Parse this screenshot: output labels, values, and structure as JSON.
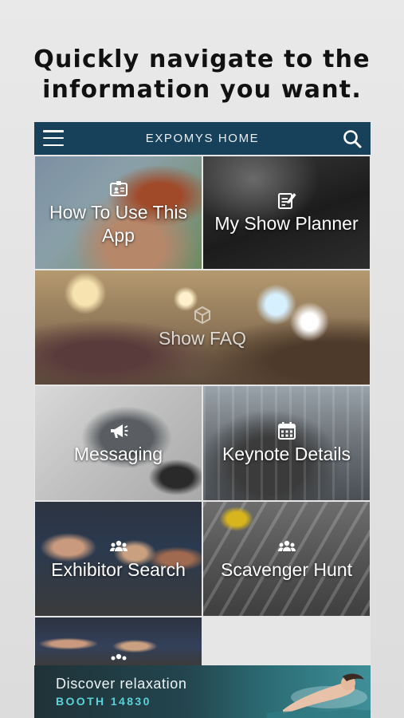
{
  "headline": {
    "line1": "Quickly navigate to the",
    "line2": "information you want."
  },
  "appbar": {
    "title": "EXPOMYS HOME",
    "menu_icon": "hamburger-menu-icon",
    "search_icon": "search-icon",
    "color": "#17405a"
  },
  "tiles": [
    {
      "label": "How To Use This App",
      "icon": "badge-icon"
    },
    {
      "label": "My Show Planner",
      "icon": "planner-edit-icon"
    },
    {
      "label": "Show FAQ",
      "icon": "cube-icon"
    },
    {
      "label": "Messaging",
      "icon": "megaphone-icon"
    },
    {
      "label": "Keynote Details",
      "icon": "calendar-icon"
    },
    {
      "label": "Exhibitor Search",
      "icon": "people-icon"
    },
    {
      "label": "Scavenger Hunt",
      "icon": "people-icon"
    }
  ],
  "banner": {
    "line1": "Discover relaxation",
    "line2": "BOOTH 14830",
    "accent": "#5bd2d8"
  }
}
